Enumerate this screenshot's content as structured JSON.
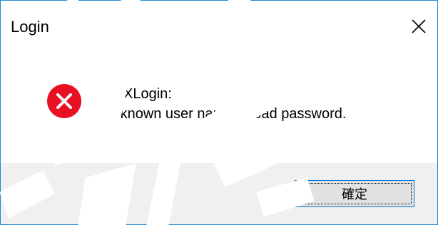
{
  "window": {
    "title": "Login",
    "close_icon": "close-icon",
    "border_color": "#1e8ad6"
  },
  "message": {
    "icon": "error-icon",
    "icon_color": "#e81123",
    "line1": "trFIXLogin:",
    "line2": "Unknown user name or bad password."
  },
  "footer": {
    "ok_label": "確定",
    "background": "#f0f0f0"
  },
  "watermark": {
    "color": "#ffffff"
  }
}
